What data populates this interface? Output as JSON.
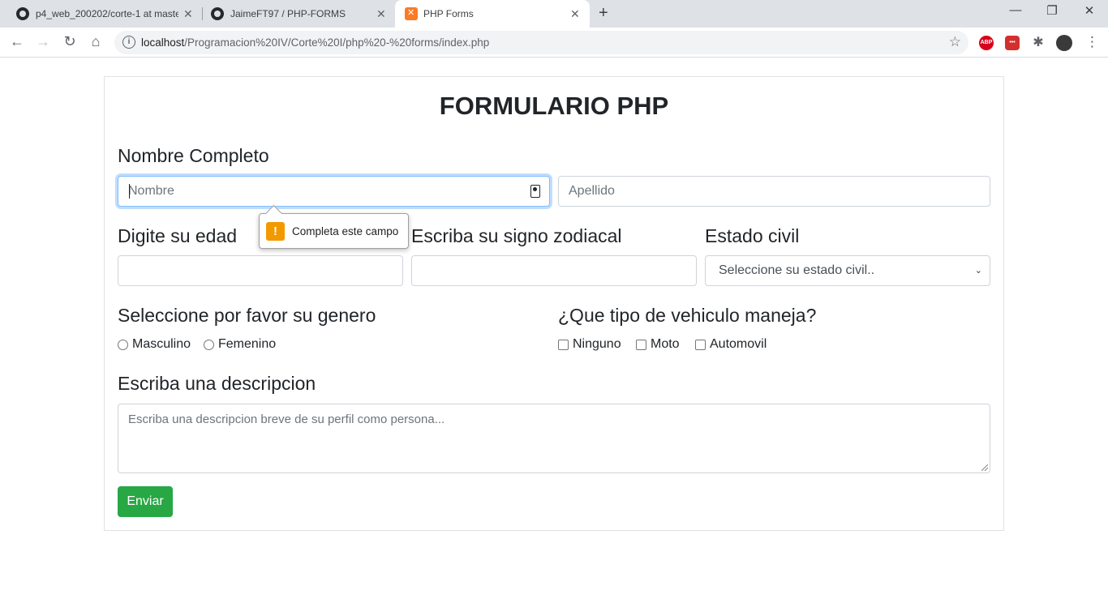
{
  "browser": {
    "tabs": [
      {
        "title": "p4_web_200202/corte-1 at maste",
        "icon": "github-icon"
      },
      {
        "title": "JaimeFT97 / PHP-FORMS",
        "icon": "github-icon"
      },
      {
        "title": "PHP Forms",
        "icon": "xampp-icon"
      }
    ],
    "url_host": "localhost",
    "url_path": "/Programacion%20IV/Corte%20I/php%20-%20forms/index.php",
    "extensions": {
      "abp": "ABP",
      "red": "•••"
    }
  },
  "form": {
    "title": "FORMULARIO PHP",
    "nombre_completo_label": "Nombre Completo",
    "nombre_placeholder": "Nombre",
    "apellido_placeholder": "Apellido",
    "edad_label": "Digite su edad",
    "signo_label": "Escriba su signo zodiacal",
    "estado_civil_label": "Estado civil",
    "estado_civil_selected": "Seleccione su estado civil..",
    "genero_label": "Seleccione por favor su genero",
    "genero_options": [
      "Masculino",
      "Femenino"
    ],
    "vehiculo_label": "¿Que tipo de vehiculo maneja?",
    "vehiculo_options": [
      "Ninguno",
      "Moto",
      "Automovil"
    ],
    "descripcion_label": "Escriba una descripcion",
    "descripcion_placeholder": "Escriba una descripcion breve de su perfil como persona...",
    "submit_label": "Enviar"
  },
  "validation_tooltip": {
    "icon": "warning-icon",
    "message": "Completa este campo"
  },
  "colors": {
    "submit": "#28a745",
    "focus_border": "#80bdff",
    "warning": "#f29900"
  }
}
